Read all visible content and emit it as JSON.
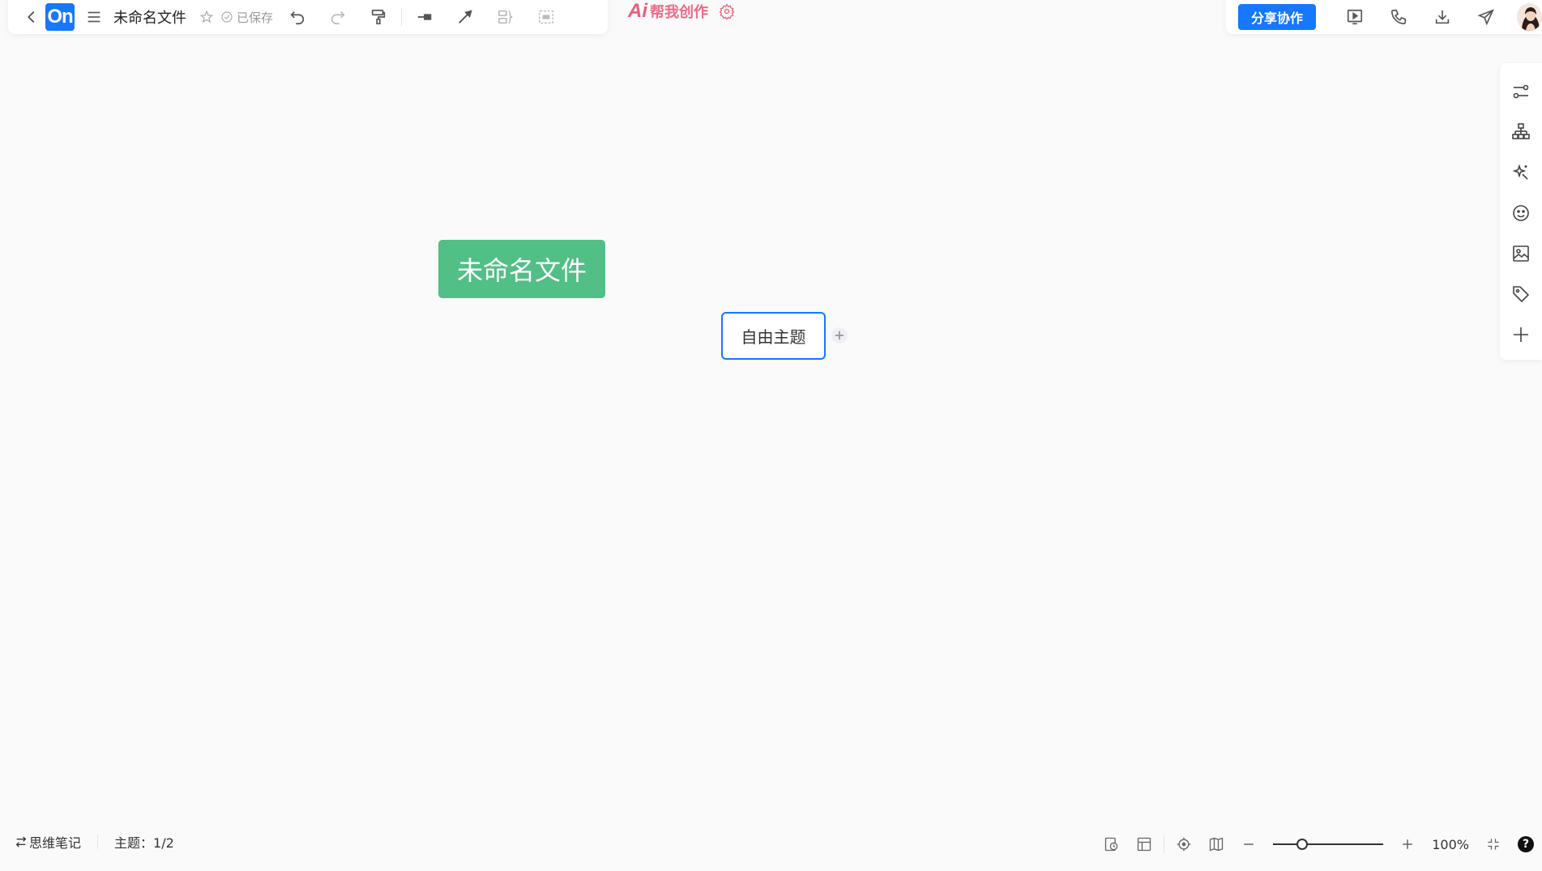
{
  "app": {
    "logo_text": "On",
    "doc_title": "未命名文件",
    "saved_status": "已保存"
  },
  "toolbar": {
    "icons": [
      "back-icon",
      "menu-icon",
      "star-icon",
      "undo-icon",
      "redo-icon",
      "format-painter-icon",
      "insert-topic-icon",
      "relation-line-icon",
      "summary-icon",
      "boundary-icon"
    ]
  },
  "ai": {
    "mark": "Ai",
    "label": "帮我创作"
  },
  "header_right": {
    "share_label": "分享协作",
    "icons": [
      "present-icon",
      "call-icon",
      "download-icon",
      "send-icon",
      "avatar"
    ]
  },
  "side_panel": {
    "icons": [
      "style-icon",
      "structure-icon",
      "ai-magic-icon",
      "emoji-icon",
      "image-icon",
      "tag-icon",
      "add-icon"
    ]
  },
  "canvas": {
    "root_topic": "未命名文件",
    "free_topic": "自由主题",
    "add_child": "+"
  },
  "status_bar": {
    "mode_label": "思维笔记",
    "topic_count": "主题：1/2",
    "zoom_level": "100%",
    "zoom_value_fraction": 0.24,
    "help": "?"
  },
  "colors": {
    "accent": "#1677ff",
    "root_topic_bg": "#52bf86",
    "ai": "#ef6a87",
    "canvas_bg": "#fafafa"
  }
}
